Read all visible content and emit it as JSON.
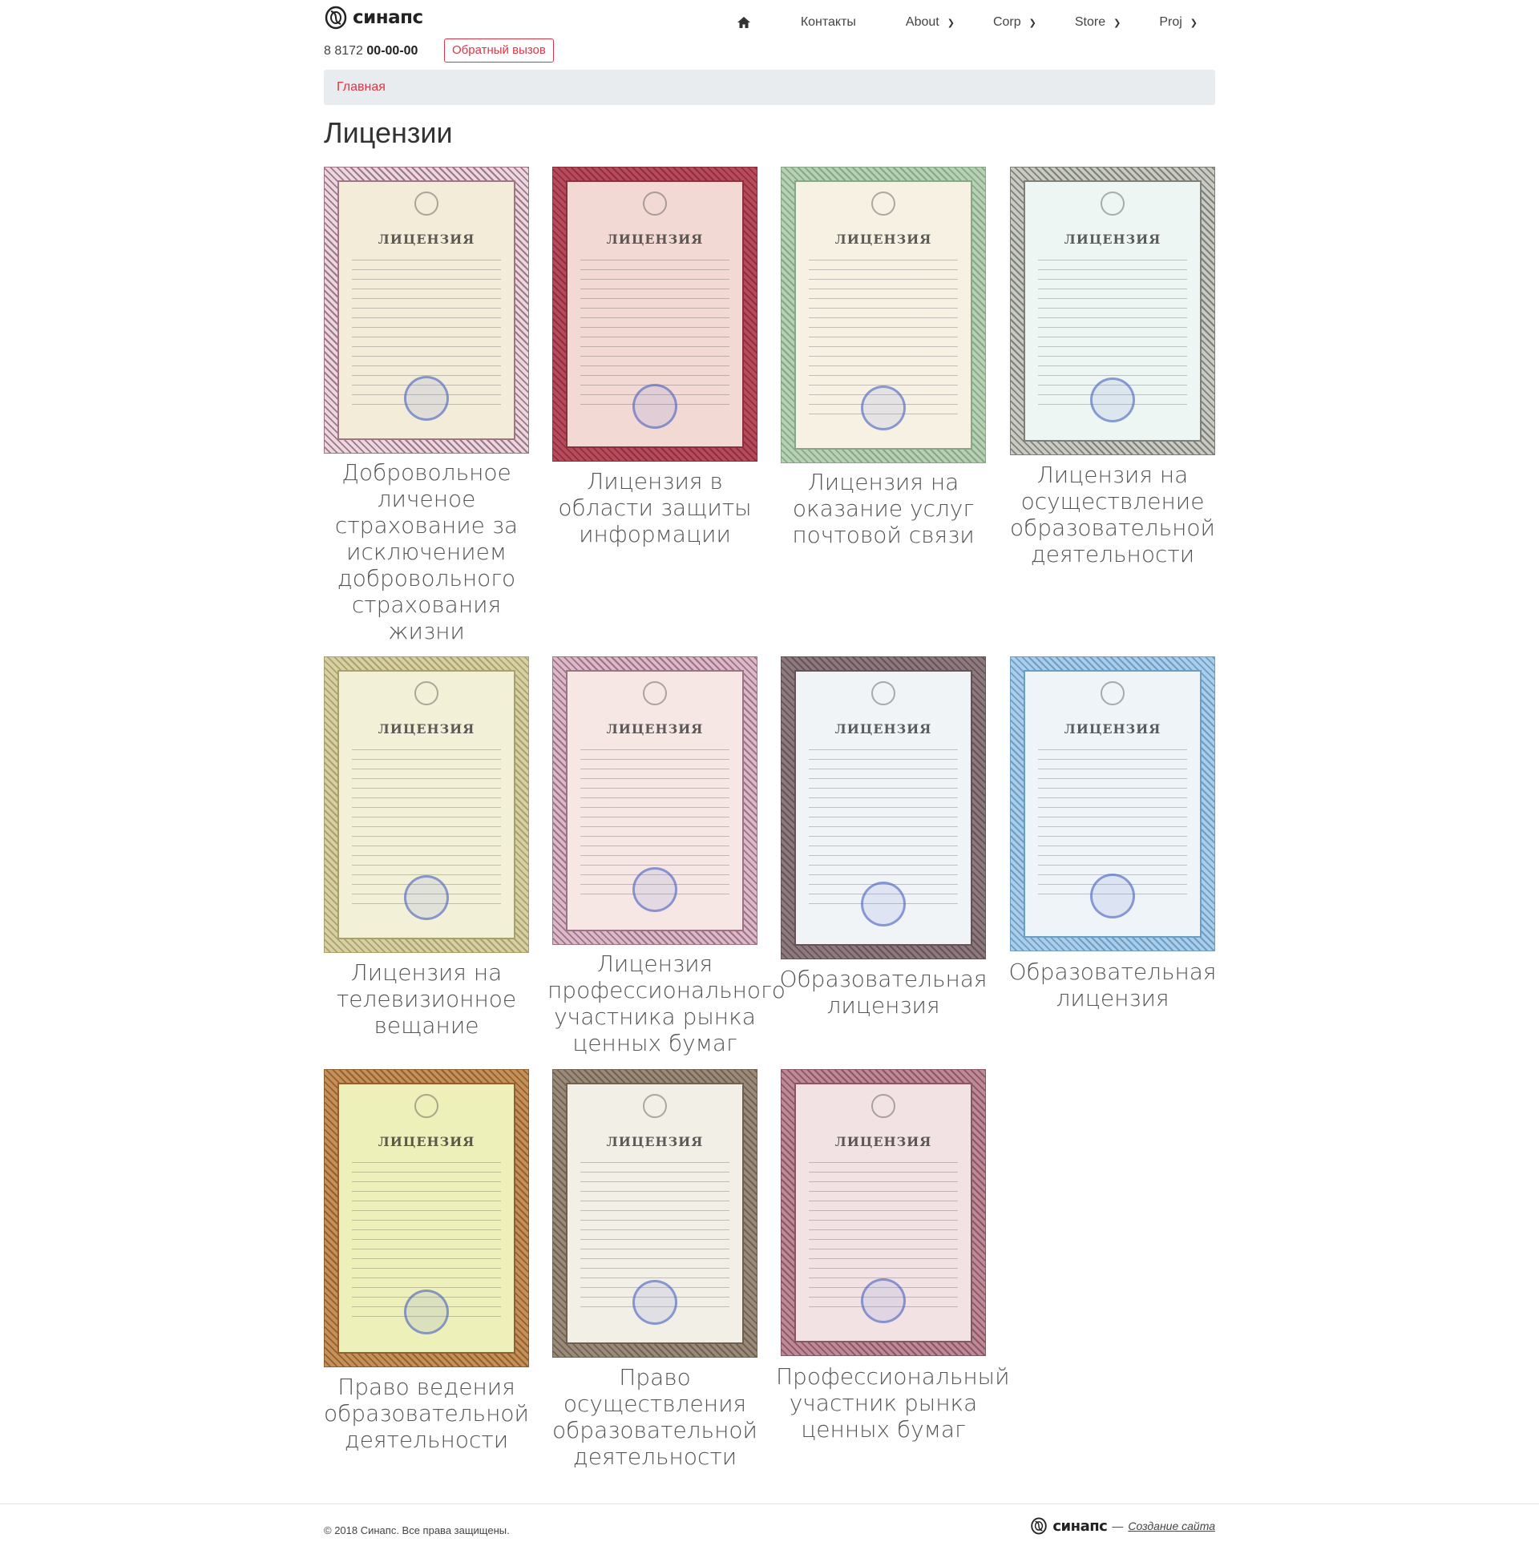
{
  "header": {
    "logo_text": "синапс",
    "phone_prefix": "8 8172",
    "phone_number": "00-00-00",
    "callback_label": "Обратный вызов",
    "nav": {
      "contacts": "Контакты",
      "about": "About",
      "corp": "Corp",
      "store": "Store",
      "proj": "Proj"
    }
  },
  "breadcrumb": {
    "home": "Главная"
  },
  "page_title": "Лицензии",
  "licenses": [
    {
      "caption": "Добровольное личеное страхование за исключением добровольного страхования жизни",
      "cert_word": "ЛИЦЕНЗИЯ",
      "bg": "#e9d8df",
      "border": "#a07585",
      "inner": "#f2ecd8"
    },
    {
      "caption": "Лицензия в области защиты информации",
      "cert_word": "ЛИЦЕНЗИЯ",
      "bg": "#b84b5b",
      "border": "#8e2f3f",
      "inner": "#f3d9d4"
    },
    {
      "caption": "Лицензия на оказание услуг почтовой связи",
      "cert_word": "ЛИЦЕНЗИЯ",
      "bg": "#b5d3b2",
      "border": "#8aa688",
      "inner": "#f7f1e4"
    },
    {
      "caption": "Лицензия на осуществление образовательной деятельности",
      "cert_word": "ЛИЦЕНЗИЯ",
      "bg": "#c9cbc3",
      "border": "#7d8078",
      "inner": "#eef6f3"
    },
    {
      "caption": "Лицензия на телевизионное вещание",
      "cert_word": "ЛИЦЕНЗИЯ",
      "bg": "#d7d0a2",
      "border": "#a9a06e",
      "inner": "#f3f0d8"
    },
    {
      "caption": "Лицензия профессионального участника рынка ценных бумаг",
      "cert_word": "ЛИЦЕНЗИЯ",
      "bg": "#dcb9c8",
      "border": "#9c7384",
      "inner": "#f6e7e4"
    },
    {
      "caption": "Образовательная лицензия",
      "cert_word": "ЛИЦЕНЗИЯ",
      "bg": "#8c7a7e",
      "border": "#655358",
      "inner": "#f0f4f6"
    },
    {
      "caption": "Образовательная лицензия",
      "cert_word": "ЛИЦЕНЗИЯ",
      "bg": "#a9cdea",
      "border": "#6c9ec4",
      "inner": "#eef4f7"
    },
    {
      "caption": "Право ведения образовательной деятельности",
      "cert_word": "ЛИЦЕНЗИЯ",
      "bg": "#c5915a",
      "border": "#935f2e",
      "inner": "#edf0b8"
    },
    {
      "caption": "Право осуществления образовательной деятельности",
      "cert_word": "ЛИЦЕНЗИЯ",
      "bg": "#9a8a7a",
      "border": "#6f604f",
      "inner": "#f2efe6"
    },
    {
      "caption": "Профессиональный участник рынка ценных бумаг",
      "cert_word": "ЛИЦЕНЗИЯ",
      "bg": "#bf8a98",
      "border": "#8a5565",
      "inner": "#f3e2e4"
    }
  ],
  "footer": {
    "copyright": "© 2018 Синапс. Все права защищены.",
    "logo_text": "синапс",
    "dash": "—",
    "link": "Создание сайта"
  },
  "colors": {
    "accent": "#dc3545",
    "breadcrumb_bg": "#e9ecef"
  }
}
